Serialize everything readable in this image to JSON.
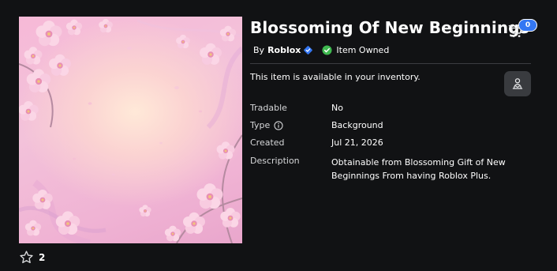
{
  "item": {
    "title": "Blossoming Of New Beginnings",
    "by_prefix": "By",
    "creator": "Roblox",
    "owned_label": "Item Owned",
    "inventory_message": "This item is available in your inventory."
  },
  "cart": {
    "count": "0"
  },
  "favorites": {
    "count": "2"
  },
  "details": {
    "tradable_label": "Tradable",
    "tradable_value": "No",
    "type_label": "Type",
    "type_value": "Background",
    "created_label": "Created",
    "created_value": "Jul 21, 2026",
    "description_label": "Description",
    "description_value": "Obtainable from Blossoming Gift of New Beginnings From having Roblox Plus."
  },
  "colors": {
    "background": "#111214",
    "verified_blue": "#3477f3",
    "owned_green": "#3fb950",
    "button_gray": "#393b3f"
  },
  "icons": {
    "cart": "shopping-cart-icon",
    "verified": "verified-badge-icon",
    "owned": "check-circle-icon",
    "info": "info-icon",
    "star": "star-outline-icon",
    "action": "try-on-icon"
  }
}
